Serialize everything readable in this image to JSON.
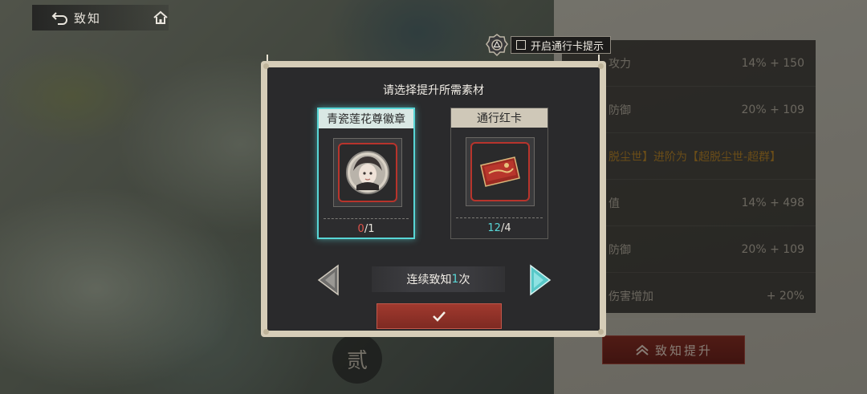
{
  "nav": {
    "title": "致知"
  },
  "hint": {
    "label": "开启通行卡提示",
    "checked": false
  },
  "dialog": {
    "title": "请选择提升所需素材",
    "cards": [
      {
        "name": "青瓷莲花尊徽章",
        "have": "0",
        "need": "/1",
        "selected": true
      },
      {
        "name": "通行红卡",
        "have": "12",
        "need": "/4",
        "selected": false
      }
    ],
    "times": {
      "prefix": "连续致知",
      "count": "1",
      "suffix": "次"
    }
  },
  "stats": {
    "rows": [
      {
        "label": "攻力",
        "value": "14% + 150"
      },
      {
        "label": "防御",
        "value": "20% + 109"
      },
      {
        "label": "脱尘世】进阶为【超脱尘世-超群】",
        "value": ""
      },
      {
        "label": "值",
        "value": "14% + 498"
      },
      {
        "label": "防御",
        "value": "20% + 109"
      },
      {
        "label": "伤害增加",
        "value": "+ 20%"
      }
    ]
  },
  "promote": {
    "label": "致知提升"
  },
  "seal": {
    "text": "贰"
  },
  "colors": {
    "accent_cyan": "#58d6d6",
    "accent_red": "#e0524a",
    "button_red": "#8a2f25"
  }
}
